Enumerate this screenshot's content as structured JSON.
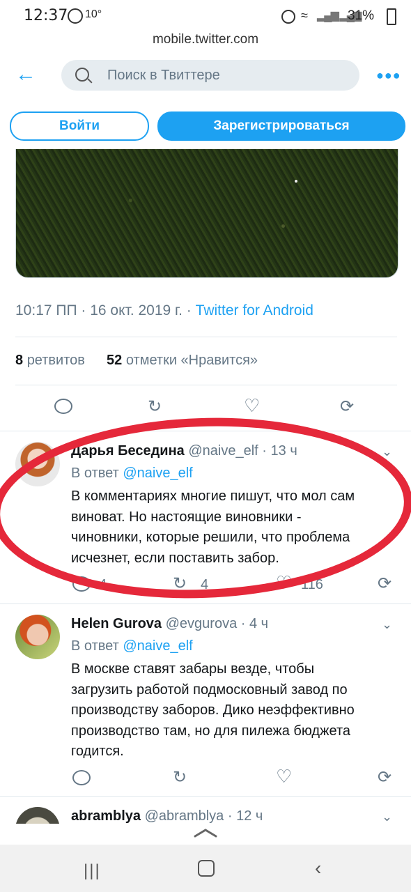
{
  "status_bar": {
    "time": "12:37",
    "temperature": "10°",
    "battery": "31%"
  },
  "url": "mobile.twitter.com",
  "header": {
    "search_placeholder": "Поиск в Твиттере"
  },
  "buttons": {
    "login": "Войти",
    "signup": "Зарегистрироваться"
  },
  "main_tweet": {
    "meta_time": "10:17 ПП · 16 окт. 2019 г. ·",
    "meta_source": "Twitter for Android",
    "retweets_count": "8",
    "retweets_label": "ретвитов",
    "likes_count": "52",
    "likes_label": "отметки «Нравится»"
  },
  "replies": [
    {
      "name": "Дарья Беседина",
      "handle": "@naive_elf",
      "time": "· 13 ч",
      "reply_prefix": "В ответ",
      "reply_to": "@naive_elf",
      "lines": [
        "В комментариях многие пишут, что мол сам",
        "виноват. Но настоящие виновники -",
        "чиновники, которые решили, что проблема",
        "исчезнет, если поставить забор."
      ],
      "replies_count": "4",
      "retweets_count": "4",
      "likes_count": "116"
    },
    {
      "name": "Helen Gurova",
      "handle": "@evgurova",
      "time": "· 4 ч",
      "reply_prefix": "В ответ",
      "reply_to": "@naive_elf",
      "lines": [
        "В москве ставят забары везде, чтобы",
        "загрузить работой подмосковный завод по",
        "производству заборов. Дико неэффективно",
        "производство там, но для пилежа бюджета",
        "годится."
      ]
    },
    {
      "name": "abramblya",
      "handle": "@abramblya",
      "time": "· 12 ч"
    }
  ],
  "colors": {
    "accent": "#1da1f2",
    "highlight": "#e5283a",
    "muted": "#657786"
  }
}
